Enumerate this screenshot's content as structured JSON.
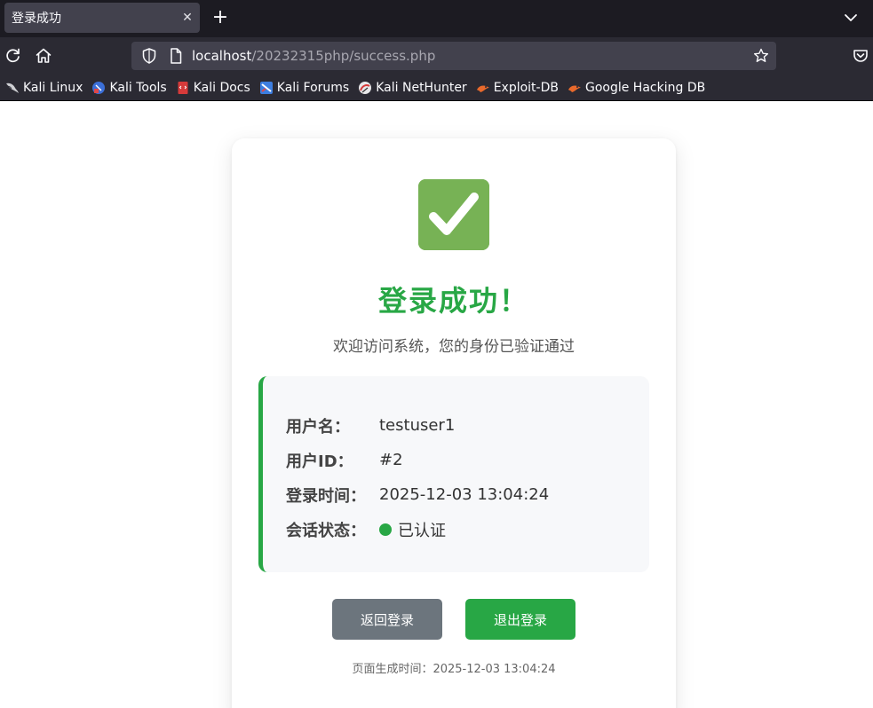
{
  "browser": {
    "tab_title": "登录成功",
    "url_host": "localhost",
    "url_path": "/20232315php/success.php",
    "bookmarks": [
      {
        "label": "Kali Linux",
        "icon": "kali-dragon-icon"
      },
      {
        "label": "Kali Tools",
        "icon": "kali-tools-icon"
      },
      {
        "label": "Kali Docs",
        "icon": "kali-docs-icon"
      },
      {
        "label": "Kali Forums",
        "icon": "kali-forums-icon"
      },
      {
        "label": "Kali NetHunter",
        "icon": "kali-nethunter-icon"
      },
      {
        "label": "Exploit-DB",
        "icon": "exploit-db-icon"
      },
      {
        "label": "Google Hacking DB",
        "icon": "google-hacking-db-icon"
      }
    ]
  },
  "page": {
    "heading": "登录成功！",
    "subtitle": "欢迎访问系统，您的身份已验证通过",
    "info": {
      "username_label": "用户名：",
      "username_value": "testuser1",
      "userid_label": "用户ID：",
      "userid_value": "#2",
      "login_time_label": "登录时间：",
      "login_time_value": "2025-12-03 13:04:24",
      "session_label": "会话状态：",
      "session_value": "已认证"
    },
    "buttons": {
      "back": "返回登录",
      "logout": "退出登录"
    },
    "generated": "页面生成时间：2025-12-03 13:04:24"
  },
  "colors": {
    "success": "#28a745",
    "secondary": "#6c757d",
    "check_bg": "#77b255",
    "chrome_dark": "#1c1b22",
    "chrome_mid": "#2b2a33",
    "urlbar": "#42414d"
  }
}
